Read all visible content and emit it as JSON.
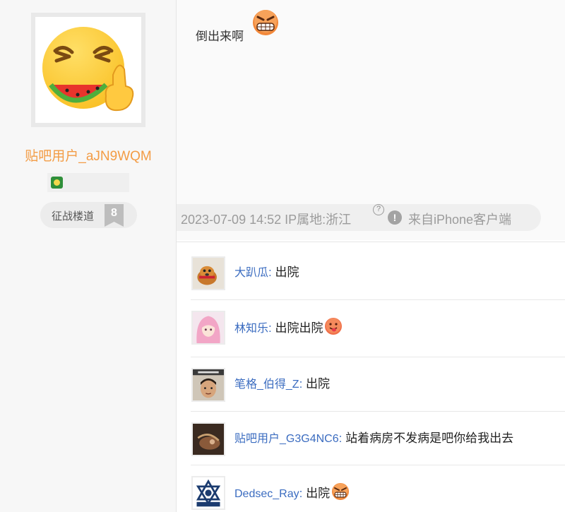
{
  "author": {
    "username": "贴吧用户_aJN9WQM",
    "rank_label": "征战楼道",
    "rank_number": "8"
  },
  "post": {
    "text": "倒出来啊",
    "date": "2023-07-09 14:52",
    "ip_location": "IP属地:浙江",
    "client": "来自iPhone客户端"
  },
  "replies": [
    {
      "name": "大趴瓜",
      "text": "出院",
      "emoji": ""
    },
    {
      "name": "林知乐",
      "text": "出院出院",
      "emoji": "tongue-emoji"
    },
    {
      "name": "笔格_伯得_Z",
      "text": "出院",
      "emoji": ""
    },
    {
      "name": "贴吧用户_G3G4NC6",
      "text": "站着病房不发病是吧你给我出去",
      "emoji": ""
    },
    {
      "name": "Dedsec_Ray",
      "text": "出院",
      "emoji": "angry-emoji"
    }
  ],
  "colors": {
    "username": "#f39c45",
    "reply_name": "#3b6cc0",
    "meta_text": "#9b9b9b"
  }
}
